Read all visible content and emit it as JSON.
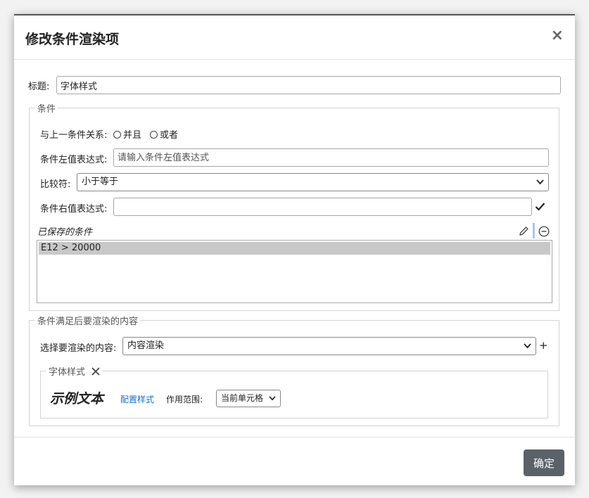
{
  "dialog": {
    "title": "修改条件渲染项",
    "close_label": "×",
    "ok_label": "确定"
  },
  "form": {
    "title_label": "标题:",
    "title_value": "字体样式"
  },
  "condition": {
    "legend": "条件",
    "relation_label": "与上一条件关系:",
    "relation_and": "并且",
    "relation_or": "或者",
    "left_label": "条件左值表达式:",
    "left_placeholder": "请输入条件左值表达式",
    "comparator_label": "比较符:",
    "comparator_value": "小于等于",
    "right_label": "条件右值表达式:",
    "right_value": "",
    "saved_label": "已保存的条件",
    "saved_items": [
      "E12 > 20000"
    ]
  },
  "render": {
    "legend": "条件满足后要渲染的内容",
    "select_label": "选择要渲染的内容:",
    "select_value": "内容渲染",
    "add_label": "+",
    "font_legend": "字体样式",
    "sample_text": "示例文本",
    "config_link": "配置样式",
    "scope_label": "作用范围:",
    "scope_value": "当前单元格"
  },
  "icons": {
    "close": "close-icon",
    "check": "check-icon",
    "edit": "pencil-icon",
    "remove": "minus-circle-icon",
    "chevron": "chevron-down-icon",
    "remove_style": "x-icon"
  },
  "colors": {
    "primary_button": "#5a6268",
    "link": "#1a6fd4",
    "accent_bar": "#a9c6e8"
  }
}
